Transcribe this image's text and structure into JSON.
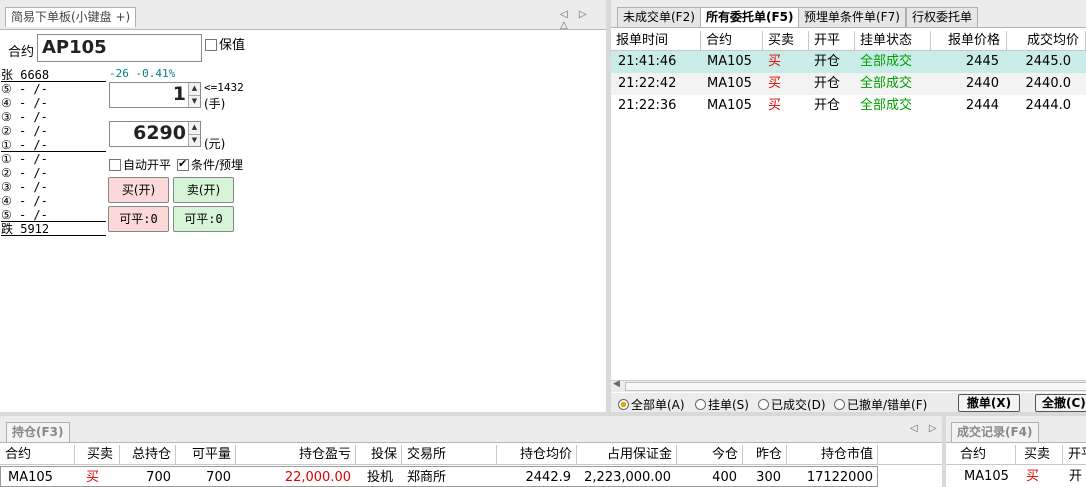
{
  "left_panel": {
    "tab_label": "简易下单板(小键盘 +)",
    "contract_label": "合约",
    "contract_value": "AP105",
    "hedge_label": "保值",
    "change_text": "-26 -0.41%",
    "limit_up": "张 6668",
    "asks": [
      "⑤ - /-",
      "④ - /-",
      "③ - /-",
      "② - /-",
      "① - /-"
    ],
    "bids": [
      "① - /-",
      "② - /-",
      "③ - /-",
      "④ - /-",
      "⑤ - /-"
    ],
    "limit_down": "跌 5912",
    "qty_value": "1",
    "qty_max": "<=1432",
    "qty_unit": "(手)",
    "price_value": "6290",
    "price_unit": "(元)",
    "auto_open_close": "自动开平",
    "condition_label": "条件/预埋",
    "buy_open": "买(开)",
    "sell_open": "卖(开)",
    "buy_closable": "可平:0",
    "sell_closable": "可平:0"
  },
  "orders_panel": {
    "tabs": [
      "未成交单(F2)",
      "所有委托单(F5)",
      "预埋单条件单(F7)",
      "行权委托单"
    ],
    "columns": [
      "报单时间",
      "合约",
      "买卖",
      "开平",
      "挂单状态",
      "报单价格",
      "成交均价"
    ],
    "rows": [
      {
        "time": "21:41:46",
        "contract": "MA105",
        "side": "买",
        "oc": "开仓",
        "status": "全部成交",
        "price": "2445",
        "avg": "2445.0"
      },
      {
        "time": "21:22:42",
        "contract": "MA105",
        "side": "买",
        "oc": "开仓",
        "status": "全部成交",
        "price": "2440",
        "avg": "2440.0"
      },
      {
        "time": "21:22:36",
        "contract": "MA105",
        "side": "买",
        "oc": "开仓",
        "status": "全部成交",
        "price": "2444",
        "avg": "2444.0"
      }
    ],
    "filters": [
      "全部单(A)",
      "挂单(S)",
      "已成交(D)",
      "已撤单/错单(F)"
    ],
    "cancel_button": "撤单(X)",
    "cancel_all_button": "全撤(C)"
  },
  "positions_panel": {
    "tab_label": "持仓(F3)",
    "columns": [
      "合约",
      "买卖",
      "总持仓",
      "可平量",
      "持仓盈亏",
      "投保",
      "交易所",
      "持仓均价",
      "占用保证金",
      "今仓",
      "昨仓",
      "持仓市值"
    ],
    "rows": [
      {
        "contract": "MA105",
        "side": "买",
        "total": "700",
        "closable": "700",
        "pnl": "22,000.00",
        "hedge": "投机",
        "exchange": "郑商所",
        "avg": "2442.9",
        "margin": "2,223,000.00",
        "today": "400",
        "yesterday": "300",
        "value": "17122000"
      }
    ]
  },
  "trades_panel": {
    "tab_label": "成交记录(F4)",
    "columns": [
      "合约",
      "买卖",
      "开平"
    ],
    "rows": [
      {
        "contract": "MA105",
        "side": "买",
        "oc": "开"
      }
    ]
  },
  "colors": {
    "buy": "#e00000",
    "status": "#00a000",
    "selected_row": "#c9ece8",
    "buy_button": "#fbd9d9",
    "sell_button": "#d6f5d6"
  }
}
